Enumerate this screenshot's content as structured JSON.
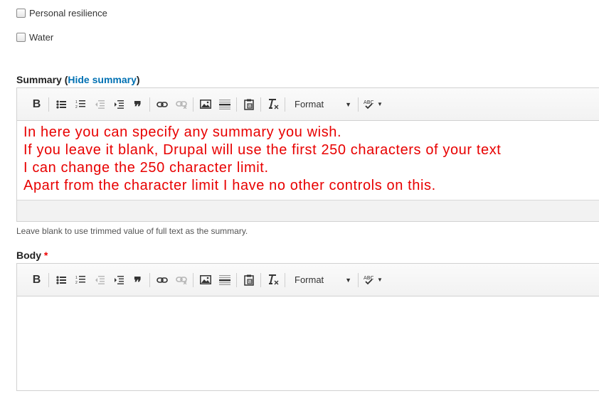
{
  "checkboxes": [
    {
      "label": "Personal resilience",
      "checked": false
    },
    {
      "label": "Water",
      "checked": false
    }
  ],
  "summary": {
    "label": "Summary",
    "open_paren": "(",
    "toggle_link": "Hide summary",
    "close_paren": ")",
    "content_lines": [
      "In here you can specify any summary you wish.",
      "If you leave it blank, Drupal will use the first 250 characters of your text",
      "I can change the 250 character limit.",
      "Apart from the character limit I have no other controls on this."
    ],
    "content_color": "#e80000",
    "description": "Leave blank to use trimmed value of full text as the summary."
  },
  "body": {
    "label": "Body",
    "required_marker": "*"
  },
  "toolbar": {
    "bold_label": "B",
    "quote_label": "❞",
    "format_label": "Format"
  },
  "colors": {
    "link": "#0071b3",
    "required": "#e00000",
    "border": "#d1d1d1"
  }
}
